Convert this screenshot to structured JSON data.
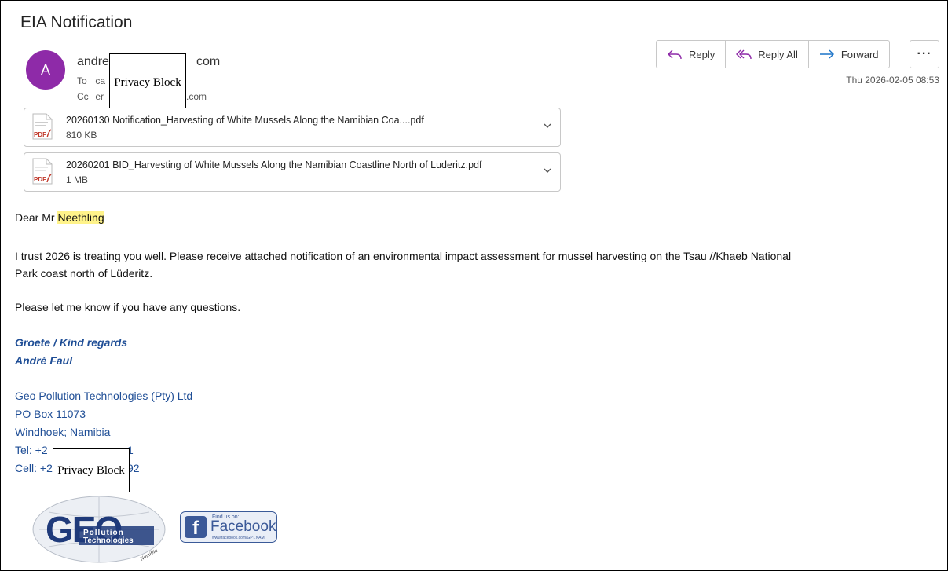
{
  "email": {
    "subject": "EIA Notification",
    "avatar_letter": "A",
    "from_start": "andre",
    "from_end": "com",
    "to_label": "To",
    "to_start": "ca",
    "cc_label": "Cc",
    "cc_start": "er",
    "cc_end": ".com",
    "date": "Thu 2026-02-05 08:53"
  },
  "privacy_block": "Privacy Block",
  "actions": {
    "reply": "Reply",
    "reply_all": "Reply All",
    "forward": "Forward",
    "more": "···"
  },
  "attachments": [
    {
      "name": "20260130 Notification_Harvesting of White Mussels Along the Namibian Coa....pdf",
      "size": "810 KB",
      "icon": "pdf-icon"
    },
    {
      "name": "20260201 BID_Harvesting of White Mussels Along the Namibian Coastline North of Luderitz.pdf",
      "size": "1 MB",
      "icon": "pdf-icon"
    }
  ],
  "body": {
    "greeting_prefix": "Dear Mr ",
    "greeting_name": "Neethling",
    "para1_line1": "I trust 2026 is treating you well. Please receive attached notification of an environmental impact assessment for mussel harvesting on the Tsau //Khaeb National",
    "para1_line2": "Park coast north of Lüderitz.",
    "para2": "Please let me know if you have any questions."
  },
  "signature": {
    "regards": "Groete / Kind regards",
    "name": "André Faul",
    "company": "Geo Pollution Technologies (Pty) Ltd",
    "po_box": "PO Box 11073",
    "city": "Windhoek; Namibia",
    "tel_start": "Tel: +2",
    "tel_end": "1",
    "cell_start": "Cell: +2",
    "cell_end": "92"
  },
  "logos": {
    "geo_main": "GEO",
    "geo_line1": "Pollution",
    "geo_line2": "Technologies",
    "geo_country": "Namibia",
    "fb_find": "Find us on:",
    "fb_word": "Facebook",
    "fb_letter": "f",
    "fb_url": "www.facebook.com/GPT.NAM"
  },
  "colors": {
    "avatar": "#8e2aa8",
    "signature_blue": "#1f4e96",
    "highlight": "#fff38a",
    "reply_icon": "#8e2aa8",
    "forward_icon": "#1a73c8"
  }
}
